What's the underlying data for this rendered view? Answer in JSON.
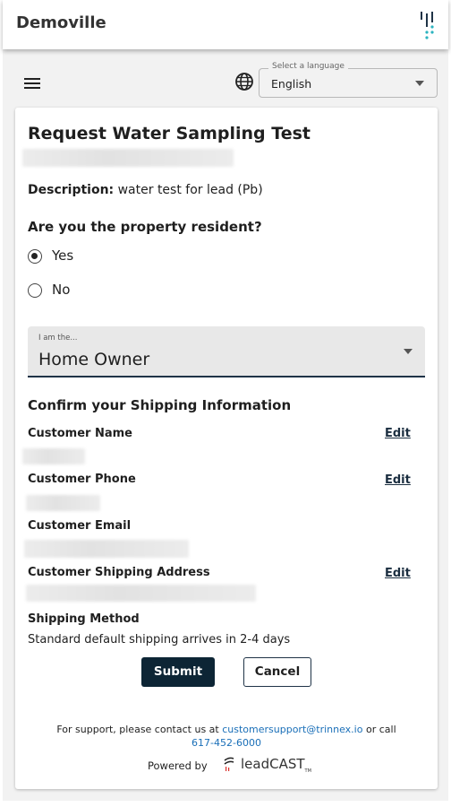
{
  "app": {
    "title": "Demoville",
    "logo_icon": "trinnex-logo-icon"
  },
  "toolbar": {
    "menu_icon": "hamburger-menu-icon",
    "language_icon": "globe-icon",
    "language_select": {
      "label": "Select a language",
      "value": "English"
    }
  },
  "form": {
    "title": "Request Water Sampling Test",
    "description_label": "Description:",
    "description_value": "water test for lead (Pb)",
    "resident_question": "Are you the property resident?",
    "resident_options": [
      {
        "label": "Yes",
        "selected": true
      },
      {
        "label": "No",
        "selected": false
      }
    ],
    "role_select": {
      "label": "I am the...",
      "value": "Home Owner"
    },
    "shipping_heading": "Confirm your Shipping Information",
    "fields": {
      "customer_name": "Customer Name",
      "customer_phone": "Customer Phone",
      "customer_email": "Customer Email",
      "customer_address": "Customer Shipping Address",
      "shipping_method": "Shipping Method"
    },
    "edit_label": "Edit",
    "shipping_method_value": "Standard default shipping arrives in 2-4 days",
    "submit_label": "Submit",
    "cancel_label": "Cancel"
  },
  "footer": {
    "support_text": "For support, please contact us at",
    "support_email": "customersupport@trinnex.io",
    "or_call": "or call",
    "support_phone": "617-452-6000",
    "powered_by": "Powered by",
    "brand_lead": "lead",
    "brand_cast": "CAST",
    "brand_tm": "TM"
  },
  "colors": {
    "primary": "#0d2535",
    "link": "#1a6fb8",
    "page_bg": "#f2f2f2"
  }
}
